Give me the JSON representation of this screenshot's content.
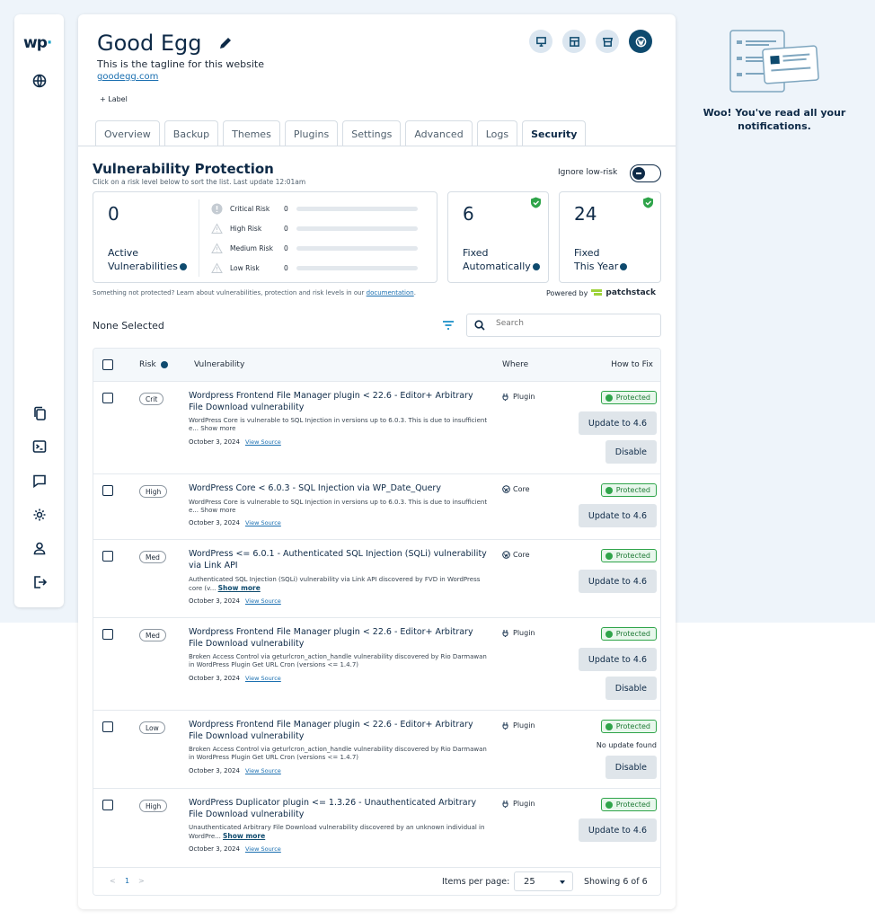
{
  "site": {
    "title": "Good Egg",
    "tagline": "This is the tagline for this website",
    "url": "goodegg.com",
    "add_label": "+ Label"
  },
  "tabs": [
    "Overview",
    "Backup",
    "Themes",
    "Plugins",
    "Settings",
    "Advanced",
    "Logs",
    "Security"
  ],
  "active_tab": "Security",
  "protection": {
    "title": "Vulnerability Protection",
    "subtitle": "Click on a risk level below to sort the list.  Last update 12:01am",
    "ignore_label": "Ignore low-risk",
    "active_count": "0",
    "active_label_1": "Active",
    "active_label_2": "Vulnerabilities",
    "risks": [
      {
        "name": "Critical Risk",
        "value": "0"
      },
      {
        "name": "High Risk",
        "value": "0"
      },
      {
        "name": "Medium Risk",
        "value": "0"
      },
      {
        "name": "Low Risk",
        "value": "0"
      }
    ],
    "fixed_auto": "6",
    "fixed_auto_l1": "Fixed",
    "fixed_auto_l2": "Automatically",
    "fixed_year": "24",
    "fixed_year_l1": "Fixed",
    "fixed_year_l2": "This Year",
    "footnote_text": "Something not protected? Learn about vulnerabilities, protection and risk levels in our ",
    "footnote_link": "documentation",
    "powered_by": "Powered by",
    "powered_brand": "patchstack"
  },
  "list": {
    "selection": "None Selected",
    "search_placeholder": "Search",
    "headers": {
      "risk": "Risk",
      "vulnerability": "Vulnerability",
      "where": "Where",
      "fix": "How to Fix"
    },
    "rows": [
      {
        "risk": "Crit",
        "title": "Wordpress Frontend File Manager plugin < 22.6 - Editor+ Arbitrary File Download vulnerability",
        "desc": "WordPress Core is vulnerable to SQL Injection in versions up to 6.0.3. This is due to insufficient e... Show more",
        "date": "October 3, 2024",
        "source": "View Source",
        "where": "Plugin",
        "status": "Protected",
        "update": "Update to 4.6",
        "disable": "Disable"
      },
      {
        "risk": "High",
        "title": "WordPress Core < 6.0.3 - SQL Injection via WP_Date_Query",
        "desc": "WordPress Core is vulnerable to SQL Injection in versions up to 6.0.3. This is due to insufficient e... Show more",
        "date": "October 3, 2024",
        "source": "View Source",
        "where": "Core",
        "status": "Protected",
        "update": "Update to 4.6"
      },
      {
        "risk": "Med",
        "title": "WordPress <= 6.0.1 - Authenticated SQL Injection (SQLi) vulnerability via Link API",
        "desc": "Authenticated SQL Injection (SQLi) vulnerability via Link API discovered by FVD in WordPress core (v...",
        "show_more": "Show more",
        "date": "October 3, 2024",
        "source": "View Source",
        "where": "Core",
        "status": "Protected",
        "update": "Update to 4.6"
      },
      {
        "risk": "Med",
        "title": "Wordpress Frontend File Manager plugin < 22.6 - Editor+ Arbitrary File Download vulnerability",
        "desc": "Broken Access Control via geturlcron_action_handle vulnerability discovered by Rio Darmawan in WordPress Plugin Get URL Cron (versions <= 1.4.7)",
        "date": "October 3, 2024",
        "source": "View Source",
        "where": "Plugin",
        "status": "Protected",
        "update": "Update to 4.6",
        "disable": "Disable"
      },
      {
        "risk": "Low",
        "title": "Wordpress Frontend File Manager plugin < 22.6 - Editor+ Arbitrary File Download vulnerability",
        "desc": "Broken Access Control via geturlcron_action_handle vulnerability discovered by Rio Darmawan in WordPress Plugin Get URL Cron (versions <= 1.4.7)",
        "date": "October 3, 2024",
        "source": "View Source",
        "where": "Plugin",
        "status": "Protected",
        "no_update": "No update found",
        "disable": "Disable"
      },
      {
        "risk": "High",
        "title": "WordPress Duplicator plugin <= 1.3.26 - Unauthenticated Arbitrary File Download vulnerability",
        "desc": "Unauthenticated Arbitrary File Download vulnerability discovered by an unknown individual in WordPre...",
        "show_more": "Show more",
        "date": "October 3, 2024",
        "source": "View Source",
        "where": "Plugin",
        "status": "Protected",
        "update": "Update to 4.6"
      }
    ],
    "pager": {
      "prev": "<",
      "page": "1",
      "next": ">",
      "items_label": "Items per page:",
      "per_page": "25",
      "showing": "Showing 6 of 6"
    }
  },
  "notifications": {
    "empty": "Woo! You've read all your notifications."
  },
  "colors": {
    "navy": "#0e2a47",
    "green": "#2fa44a",
    "link": "#1a6fb0"
  }
}
